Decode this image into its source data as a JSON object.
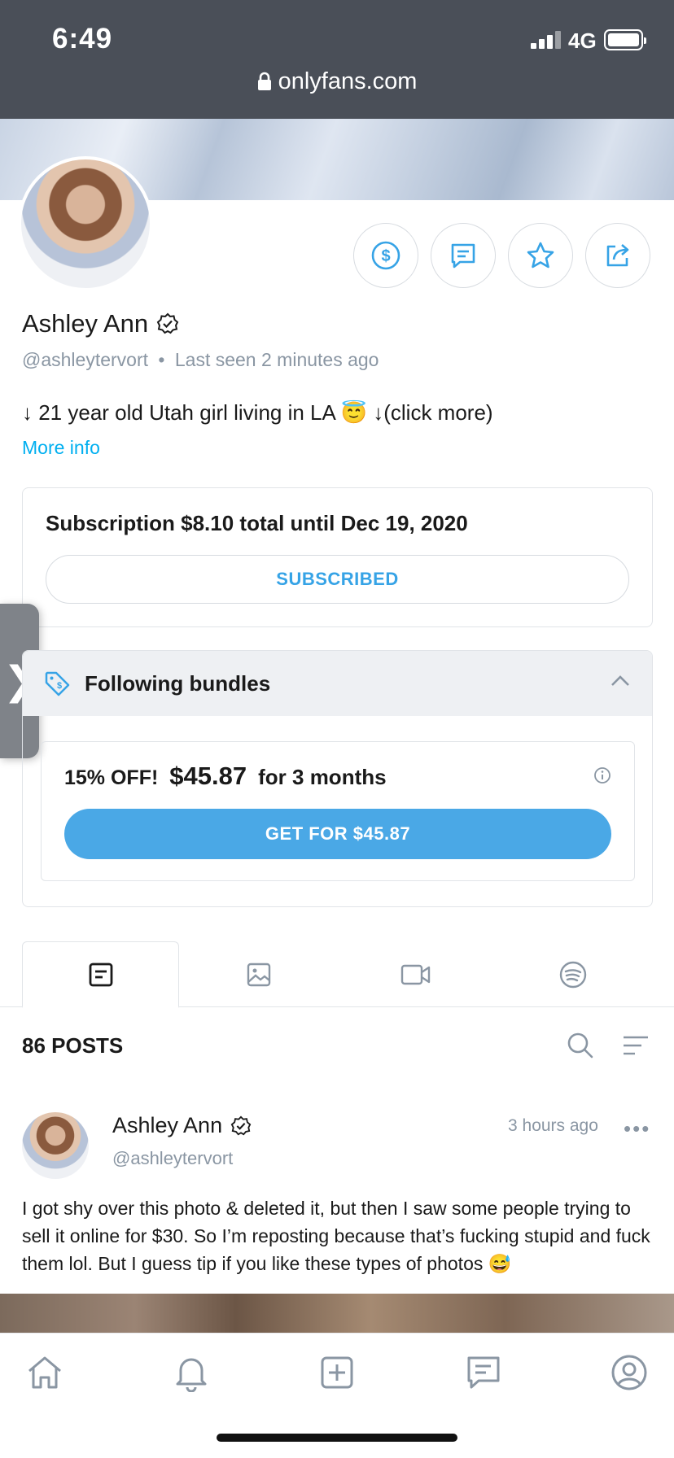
{
  "status": {
    "time": "6:49",
    "network": "4G"
  },
  "browser": {
    "url": "onlyfans.com"
  },
  "profile": {
    "name": "Ashley Ann",
    "handle": "@ashleytervort",
    "separator": "•",
    "last_seen": "Last seen 2 minutes ago",
    "bio": "↓ 21 year old Utah girl living in LA 😇 ↓(click more)",
    "more_info": "More info",
    "actions": [
      "tip-icon",
      "message-icon",
      "favorite-star-icon",
      "share-icon"
    ]
  },
  "subscription": {
    "title": "Subscription $8.10 total until Dec 19, 2020",
    "button": "SUBSCRIBED"
  },
  "sidetab": {
    "glyph": "❯"
  },
  "bundles": {
    "title": "Following bundles",
    "items": [
      {
        "discount": "15% OFF!",
        "price": "$45.87",
        "duration": "for 3 months",
        "button": "GET FOR $45.87"
      }
    ]
  },
  "tabs": [
    {
      "name": "posts",
      "icon": "posts-icon",
      "active": true
    },
    {
      "name": "photos",
      "icon": "photo-icon",
      "active": false
    },
    {
      "name": "videos",
      "icon": "video-icon",
      "active": false
    },
    {
      "name": "audio",
      "icon": "spotify-icon",
      "active": false
    }
  ],
  "posts": {
    "count_label": "86 POSTS",
    "items": [
      {
        "author": "Ashley Ann",
        "handle": "@ashleytervort",
        "time": "3 hours ago",
        "more": "•••",
        "text": "I got shy over this photo & deleted it, but then I saw some people trying to sell it online for $30. So I’m reposting because that’s fucking stupid and fuck them lol. But I guess tip if you like these types of photos 😅"
      }
    ]
  },
  "bottom_nav": [
    "home-icon",
    "notifications-icon",
    "add-post-icon",
    "messages-icon",
    "profile-icon"
  ],
  "colors": {
    "accent": "#00aff0",
    "button_blue": "#4aa8e6",
    "muted": "#8a96a3",
    "statusbar": "#4a4f58"
  }
}
